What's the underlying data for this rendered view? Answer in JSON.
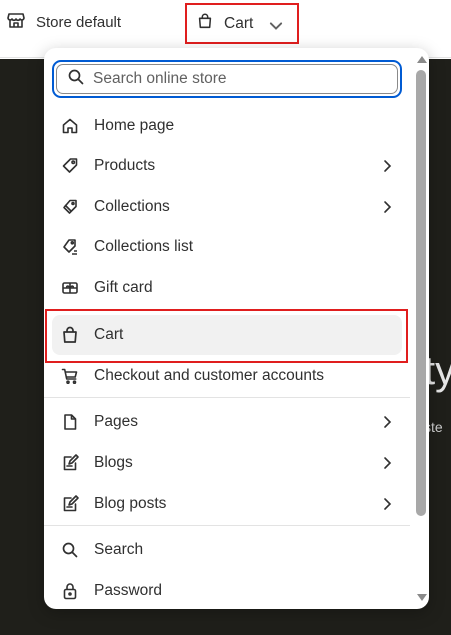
{
  "topbar": {
    "store_label": "Store default",
    "page_selector_label": "Cart"
  },
  "background": {
    "heading_fragment": "ty",
    "text_fragment": "ste"
  },
  "menu": {
    "search_placeholder": "Search online store",
    "items": [
      {
        "label": "Home page",
        "icon": "home-icon",
        "has_submenu": false
      },
      {
        "label": "Products",
        "icon": "tag-icon",
        "has_submenu": true
      },
      {
        "label": "Collections",
        "icon": "tags-icon",
        "has_submenu": true
      },
      {
        "label": "Collections list",
        "icon": "tags-list-icon",
        "has_submenu": false
      },
      {
        "label": "Gift card",
        "icon": "gift-card-icon",
        "has_submenu": false
      },
      {
        "label": "Cart",
        "icon": "bag-icon",
        "has_submenu": false,
        "selected": true
      },
      {
        "label": "Checkout and customer accounts",
        "icon": "cart-icon",
        "has_submenu": false
      },
      {
        "label": "Pages",
        "icon": "page-icon",
        "has_submenu": true
      },
      {
        "label": "Blogs",
        "icon": "blog-icon",
        "has_submenu": true
      },
      {
        "label": "Blog posts",
        "icon": "blog-post-icon",
        "has_submenu": true
      },
      {
        "label": "Search",
        "icon": "search-icon",
        "has_submenu": false
      },
      {
        "label": "Password",
        "icon": "lock-icon",
        "has_submenu": false
      }
    ]
  },
  "colors": {
    "focus_ring": "#005bd3",
    "highlight_box": "#e01e1e",
    "selected_bg": "#f1f1f1",
    "dark_background": "#1f1f1a"
  }
}
